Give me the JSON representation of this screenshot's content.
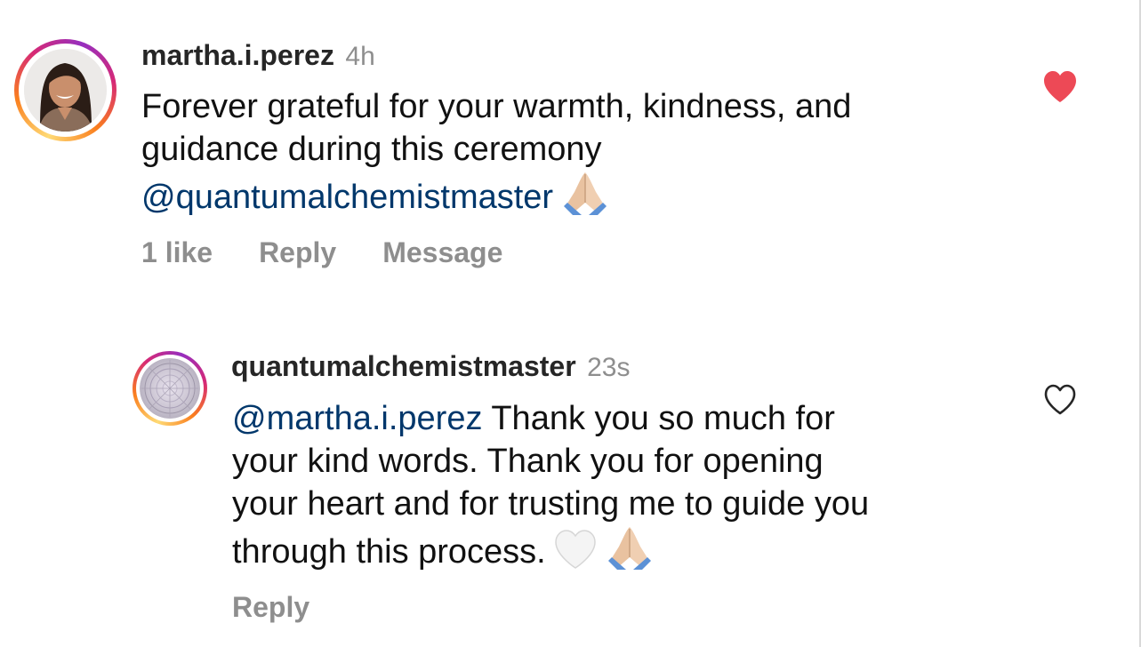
{
  "comments": [
    {
      "username": "martha.i.perez",
      "time": "4h",
      "text_lines": [
        "Forever grateful for your warmth, kindness, and",
        "guidance during this ceremony"
      ],
      "mention": "@quantumalchemistmaster",
      "emoji": "folded-hands",
      "likes": "1 like",
      "reply_label": "Reply",
      "message_label": "Message",
      "liked": true
    },
    {
      "username": "quantumalchemistmaster",
      "time": "23s",
      "mention": "@martha.i.perez",
      "text_first": "Thank you so much for",
      "text_lines": [
        "your kind words. Thank you for opening",
        "your heart and for trusting me to guide you",
        "through this process."
      ],
      "emojis": [
        "white-heart",
        "folded-hands"
      ],
      "reply_label": "Reply",
      "liked": false
    }
  ],
  "colors": {
    "liked_heart": "#ed4956",
    "mention": "#00376b",
    "secondary_text": "#8e8e8e"
  }
}
